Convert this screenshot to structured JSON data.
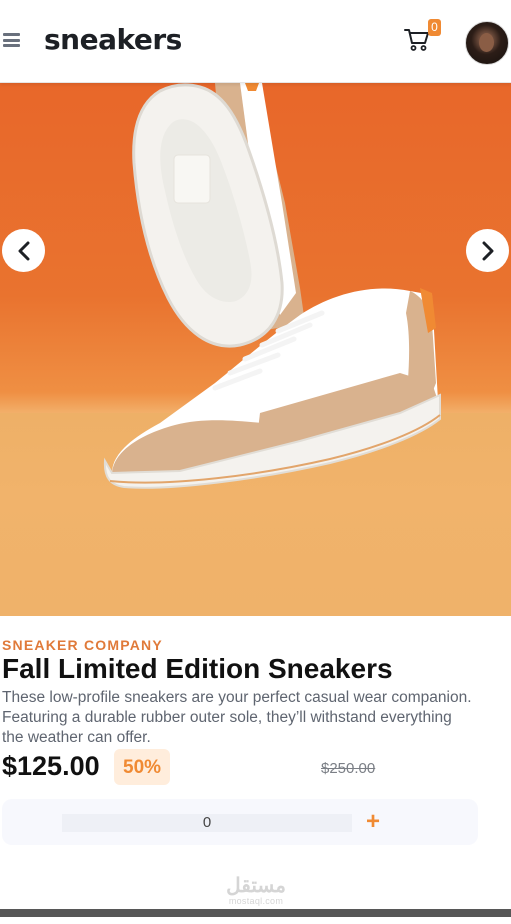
{
  "header": {
    "logo": "sneakers",
    "cart_count": "0",
    "menu_icon": "hamburger-menu-icon",
    "cart_icon": "shopping-cart-icon",
    "avatar": "user-avatar"
  },
  "gallery": {
    "prev_icon": "chevron-left-icon",
    "next_icon": "chevron-right-icon"
  },
  "product": {
    "company": "SNEAKER COMPANY",
    "title": "Fall Limited Edition Sneakers",
    "description_lines": [
      "These low-profile sneakers are your perfect casual wear companion.",
      "Featuring a durable rubber outer sole, they’ll withstand everything",
      "the weather can offer."
    ],
    "price": "$125.00",
    "discount": "50%",
    "original_price": "$250.00"
  },
  "quantity": {
    "value": "0",
    "plus_label": "+"
  },
  "watermark": {
    "arabic": "مستقل",
    "latin": "mostaql.com"
  },
  "colors": {
    "accent": "#f08a33",
    "accent_soft": "#ffeddc",
    "dark_text": "#111111",
    "muted_text": "#5f6570"
  }
}
